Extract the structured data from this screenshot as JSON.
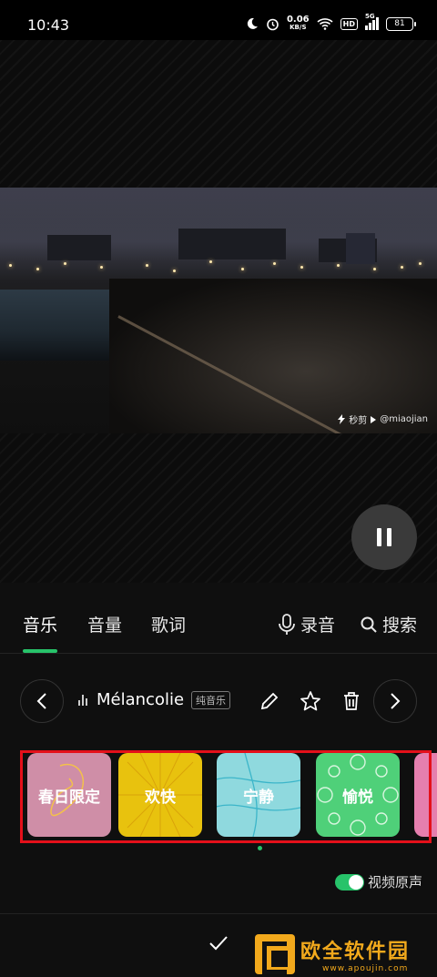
{
  "status_bar": {
    "time": "10:43",
    "network_speed": "0.06",
    "network_unit": "KB/S",
    "hd": "HD",
    "signal_label": "5G",
    "battery": "81"
  },
  "video": {
    "watermark_app": "秒剪",
    "watermark_handle": "@miaojian"
  },
  "tabs": [
    {
      "label": "音乐",
      "active": true
    },
    {
      "label": "音量",
      "active": false
    },
    {
      "label": "歌词",
      "active": false
    }
  ],
  "actions": {
    "record_label": "录音",
    "search_label": "搜索"
  },
  "track": {
    "name": "Mélancolie",
    "tag": "纯音乐"
  },
  "styles": [
    {
      "label": "春日限定",
      "color": "#cf8ea7"
    },
    {
      "label": "欢快",
      "color": "#e8c20e"
    },
    {
      "label": "宁静",
      "color": "#8fd9de"
    },
    {
      "label": "愉悦",
      "color": "#4fd079"
    },
    {
      "label": "",
      "color": "#e57fae"
    }
  ],
  "original_audio": {
    "label": "视频原声",
    "enabled": true
  },
  "site_logo": {
    "name": "欧全软件园",
    "url": "www.apoujin.com"
  },
  "colors": {
    "accent": "#27c36a",
    "highlight": "#e4101a"
  }
}
